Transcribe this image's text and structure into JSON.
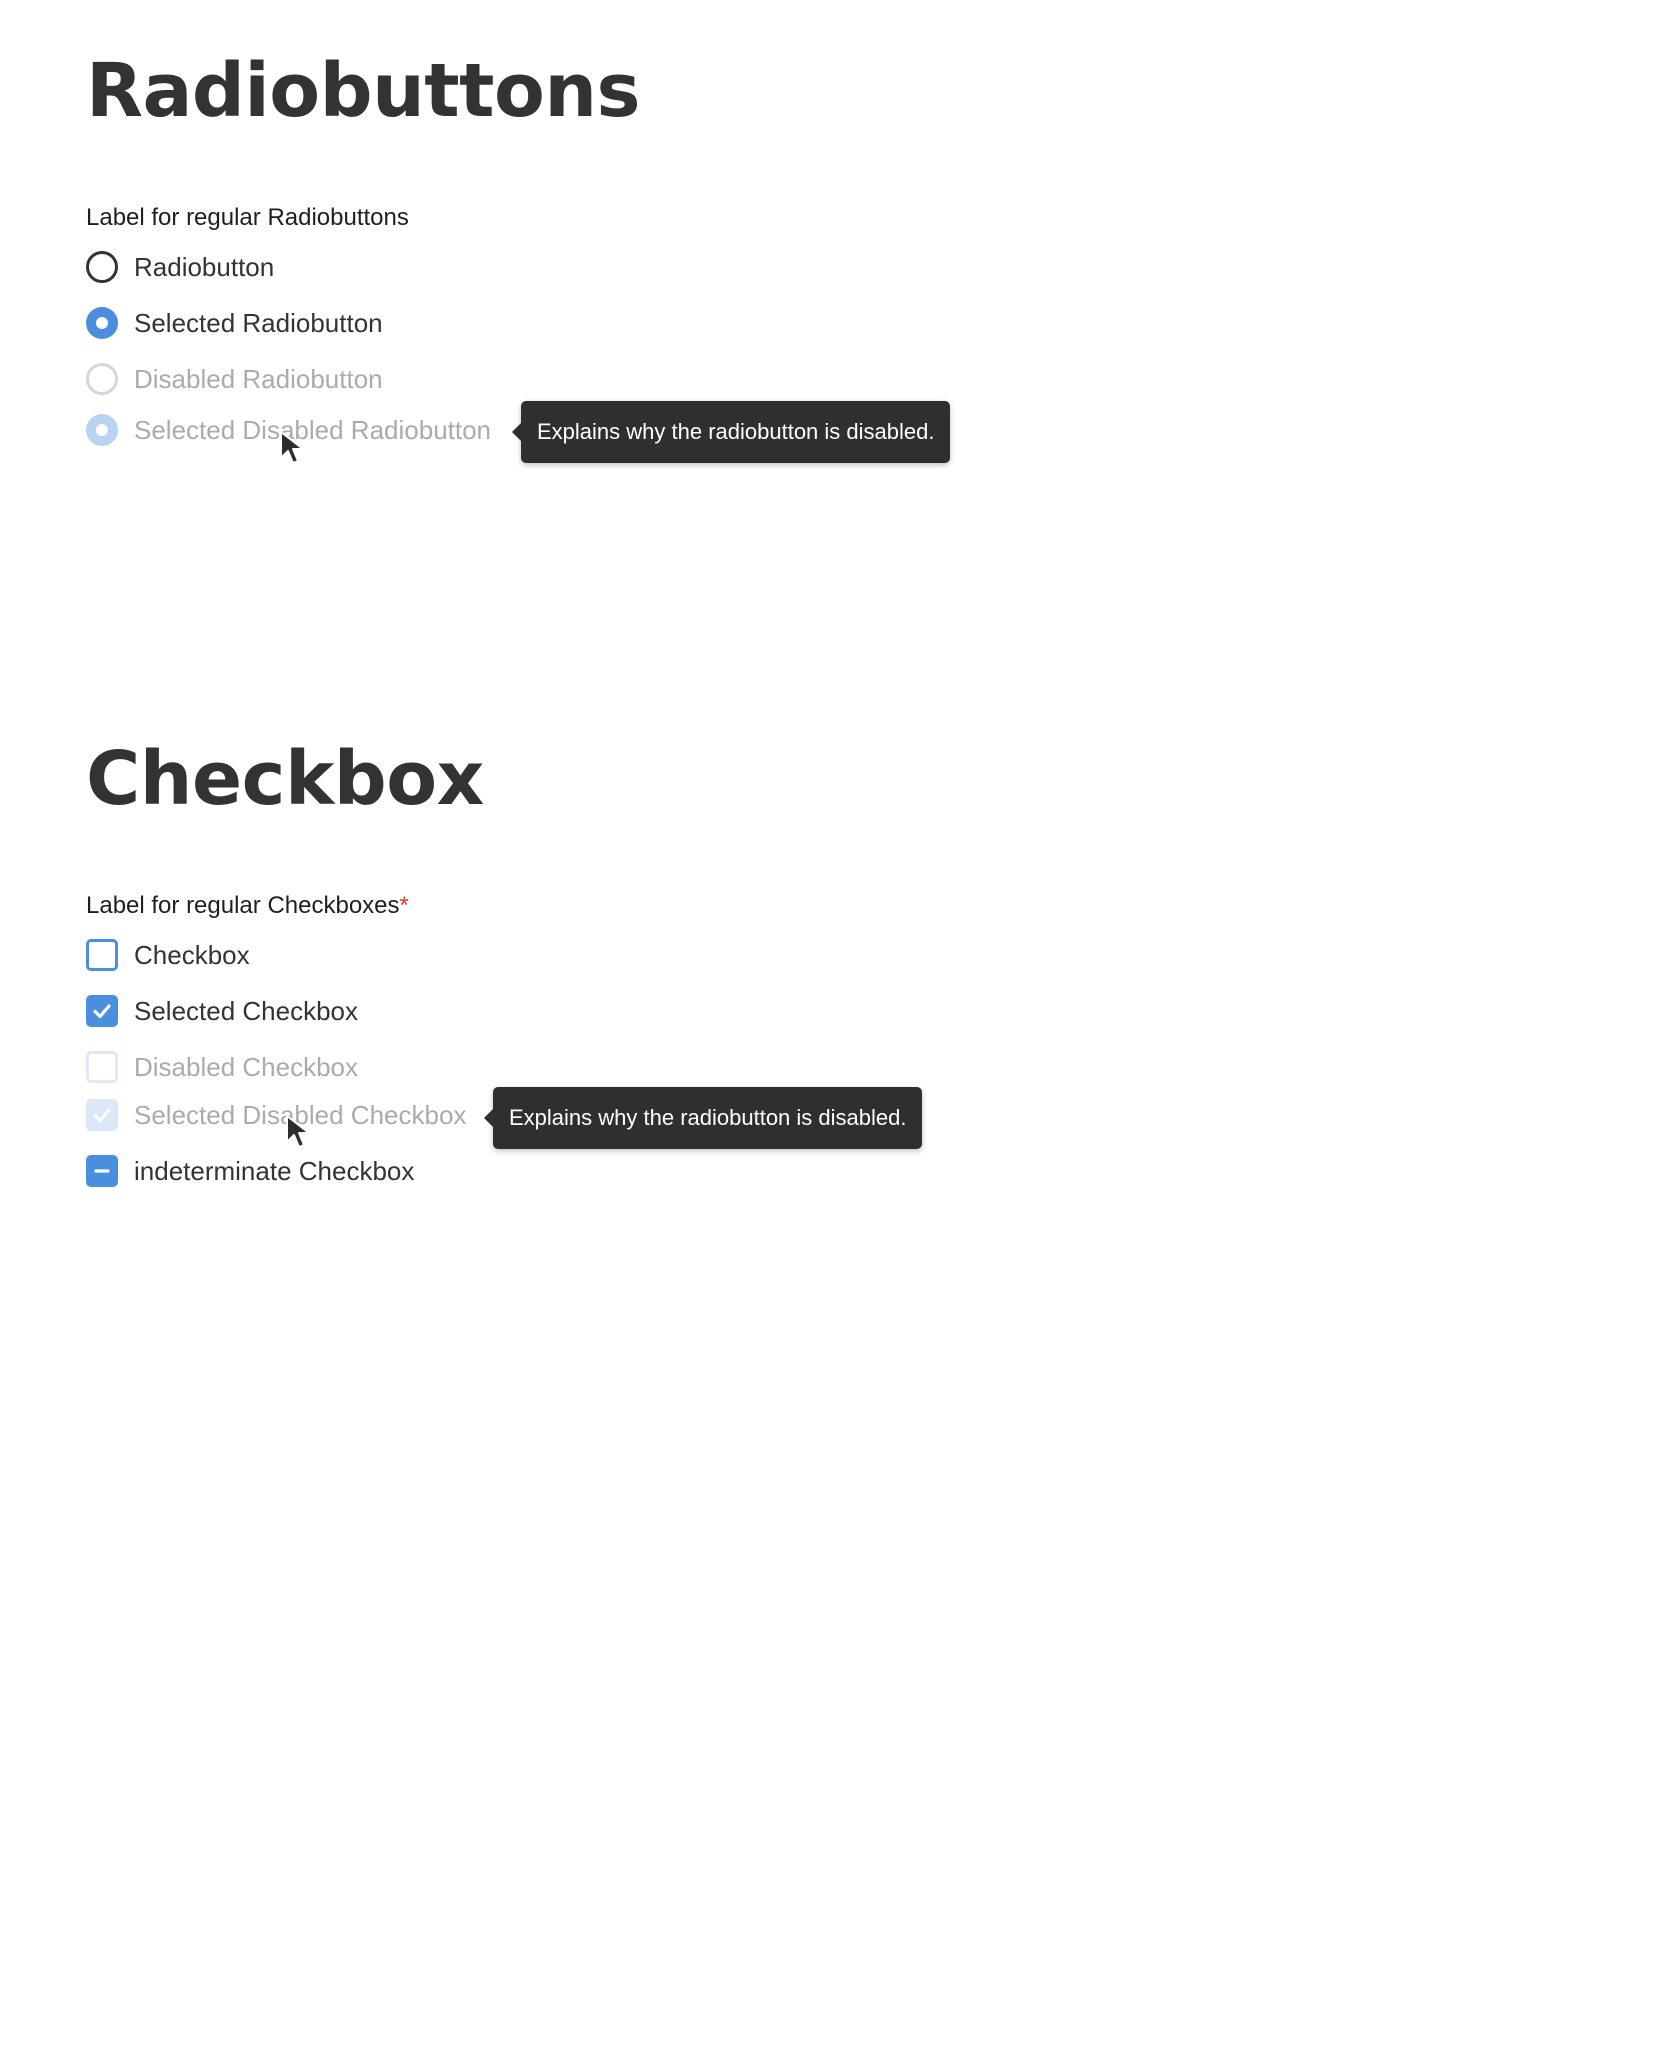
{
  "radio_section": {
    "title": "Radiobuttons",
    "group_label": "Label for regular Radiobuttons",
    "options": [
      {
        "label": "Radiobutton",
        "selected": false,
        "disabled": false
      },
      {
        "label": "Selected Radiobutton",
        "selected": true,
        "disabled": false
      },
      {
        "label": "Disabled Radiobutton",
        "selected": false,
        "disabled": true
      },
      {
        "label": "Selected Disabled Radiobutton",
        "selected": true,
        "disabled": true
      }
    ],
    "tooltip": "Explains why the radiobutton is disabled."
  },
  "checkbox_section": {
    "title": "Checkbox",
    "group_label": "Label for regular Checkboxes",
    "required_marker": "*",
    "options": [
      {
        "label": "Checkbox",
        "state": "unchecked",
        "disabled": false
      },
      {
        "label": "Selected Checkbox",
        "state": "checked",
        "disabled": false
      },
      {
        "label": "Disabled Checkbox",
        "state": "unchecked",
        "disabled": true
      },
      {
        "label": "Selected Disabled Checkbox",
        "state": "checked",
        "disabled": true
      },
      {
        "label": "indeterminate Checkbox",
        "state": "indeterminate",
        "disabled": false
      }
    ],
    "tooltip": "Explains why the radiobutton is disabled."
  },
  "colors": {
    "accent": "#4a8ee0",
    "text": "#333333",
    "disabled_text": "#ababab",
    "tooltip_bg": "#2f2f2f",
    "required": "#e0392b"
  }
}
